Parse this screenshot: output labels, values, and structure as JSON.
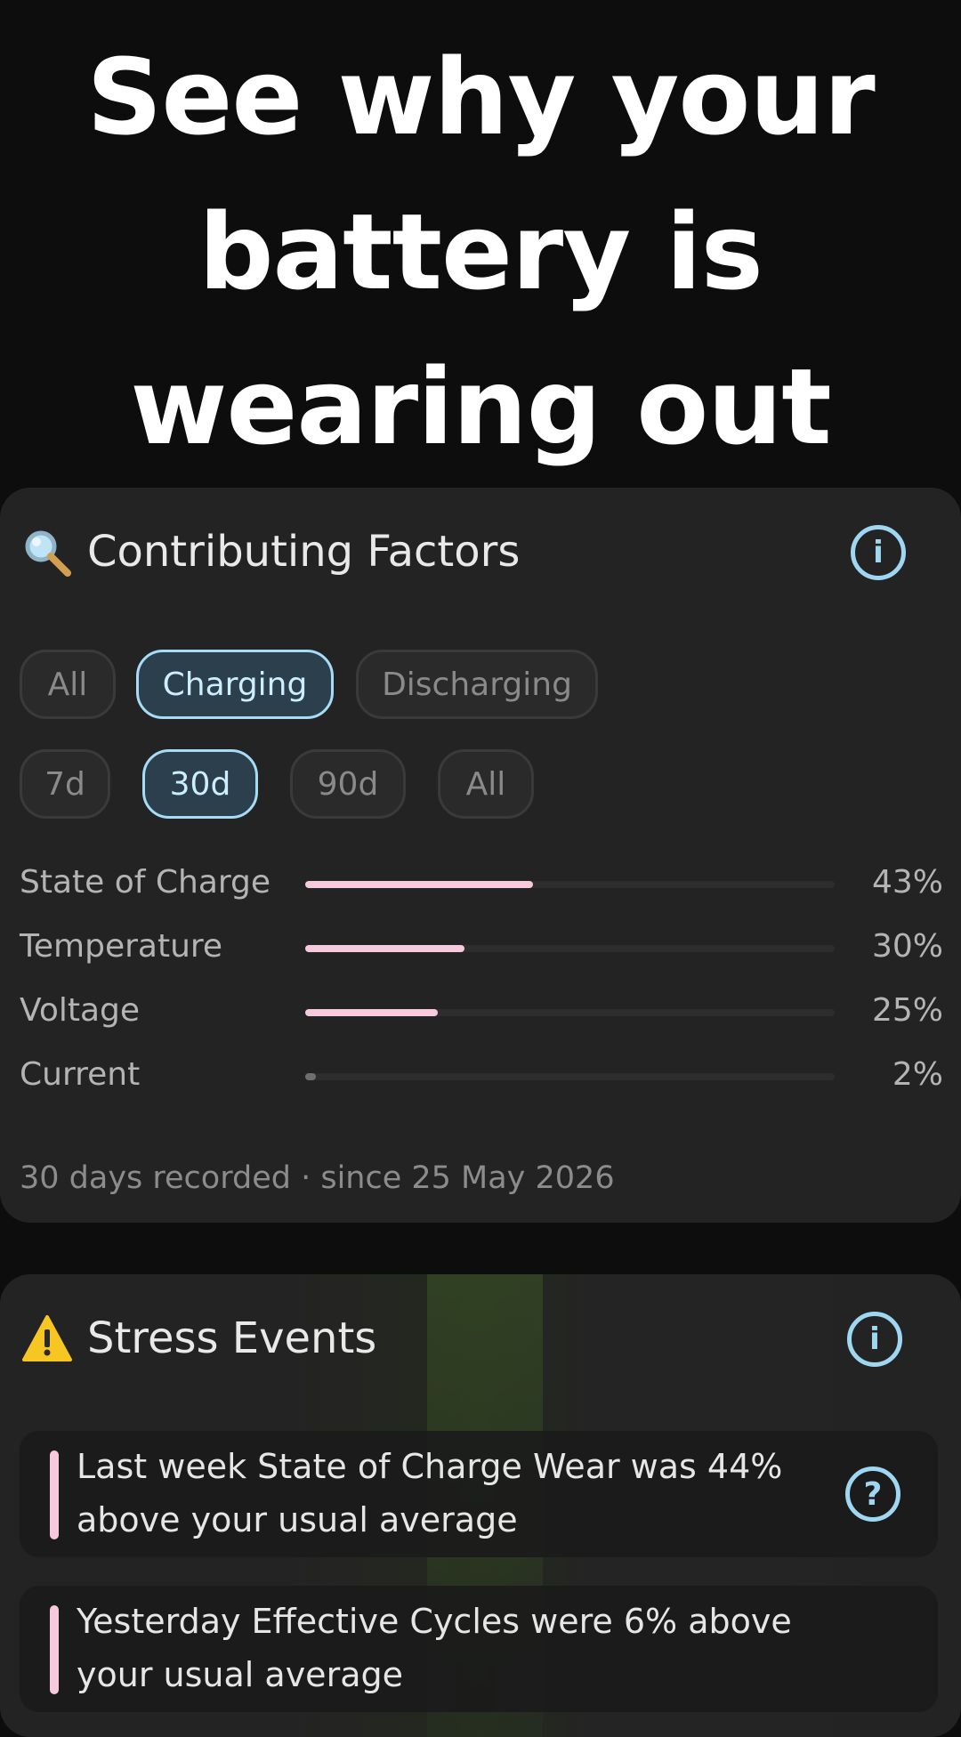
{
  "headline": {
    "line1": "See why your",
    "line2": "battery is",
    "line3": "wearing out"
  },
  "factors": {
    "title": "Contributing Factors",
    "title_icon": "magnifier-icon",
    "info_icon": "info-icon",
    "info_glyph": "i",
    "mode_chips": [
      {
        "label": "All",
        "active": false
      },
      {
        "label": "Charging",
        "active": true
      },
      {
        "label": "Discharging",
        "active": false
      }
    ],
    "range_chips": [
      {
        "label": "7d",
        "active": false
      },
      {
        "label": "30d",
        "active": true
      },
      {
        "label": "90d",
        "active": false
      },
      {
        "label": "All",
        "active": false
      }
    ],
    "rows": [
      {
        "label": "State of Charge",
        "percent": "43%",
        "value": 0.43
      },
      {
        "label": "Temperature",
        "percent": "30%",
        "value": 0.3
      },
      {
        "label": "Voltage",
        "percent": "25%",
        "value": 0.25
      },
      {
        "label": "Current",
        "percent": "2%",
        "value": 0.02
      }
    ],
    "footnote": "30 days recorded · since 25 May 2026"
  },
  "stress": {
    "title": "Stress Events",
    "title_icon": "warning-icon",
    "info_icon": "info-icon",
    "info_glyph": "i",
    "help_glyph": "?",
    "events": [
      {
        "text": "Last week State of Charge Wear was 44% above your usual average",
        "has_help": true
      },
      {
        "text": "Yesterday Effective Cycles were 6% above your usual average",
        "has_help": false
      }
    ]
  },
  "colors": {
    "accent": "#9fd6f2",
    "bar_fill": "#f7c9dc",
    "card_bg": "#232323",
    "page_bg": "#0d0d0d"
  }
}
